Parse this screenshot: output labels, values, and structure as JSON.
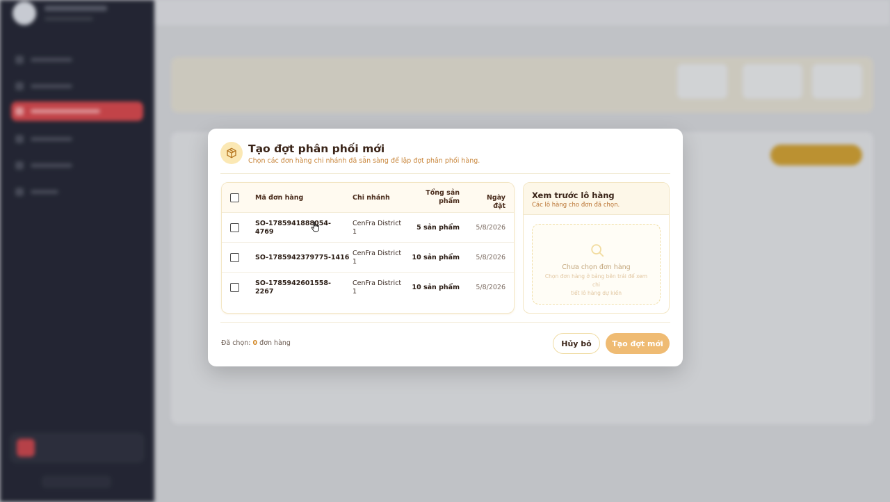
{
  "colors": {
    "accent": "#efbb73",
    "title": "#3a2418",
    "subtitle": "#c9873d",
    "sidebar": "#0f1120",
    "active_nav": "#d1353a"
  },
  "modal": {
    "icon": "package-icon",
    "title": "Tạo đợt phân phối mới",
    "subtitle": "Chọn các đơn hàng chi nhánh đã sẵn sàng để lập đợt phân phối hàng.",
    "table": {
      "headers": {
        "code": "Mã đơn hàng",
        "branch": "Chi nhánh",
        "total_line1": "Tổng sản",
        "total_line2": "phẩm",
        "date": "Ngày đặt"
      },
      "rows": [
        {
          "code_line1": "SO-178594188805​4-",
          "code_line2": "4769",
          "branch_line1": "CenFra District",
          "branch_line2": "1",
          "qty": "5 sản phẩm",
          "date": "5/8/2026",
          "checked": false
        },
        {
          "code_line1": "SO-1785942379775-1416",
          "code_line2": "",
          "branch_line1": "CenFra District",
          "branch_line2": "1",
          "qty": "10 sản phẩm",
          "date": "5/8/2026",
          "checked": false
        },
        {
          "code_line1": "SO-1785942601558-",
          "code_line2": "2267",
          "branch_line1": "CenFra District",
          "branch_line2": "1",
          "qty": "10 sản phẩm",
          "date": "5/8/2026",
          "checked": false
        }
      ]
    },
    "preview": {
      "title": "Xem trước lô hàng",
      "subtitle": "Các lô hàng cho đơn đã chọn.",
      "empty_icon": "search-icon",
      "empty_title": "Chưa chọn đơn hàng",
      "empty_sub_line1": "Chọn đơn hàng ở bảng bên trái để xem chi",
      "empty_sub_line2": "tiết lô hàng dự kiến"
    },
    "footer": {
      "selected_label": "Đã chọn:",
      "selected_count": "0",
      "selected_unit": "đơn hàng",
      "cancel_label": "Hủy bỏ",
      "create_label": "Tạo đợt mới"
    }
  }
}
